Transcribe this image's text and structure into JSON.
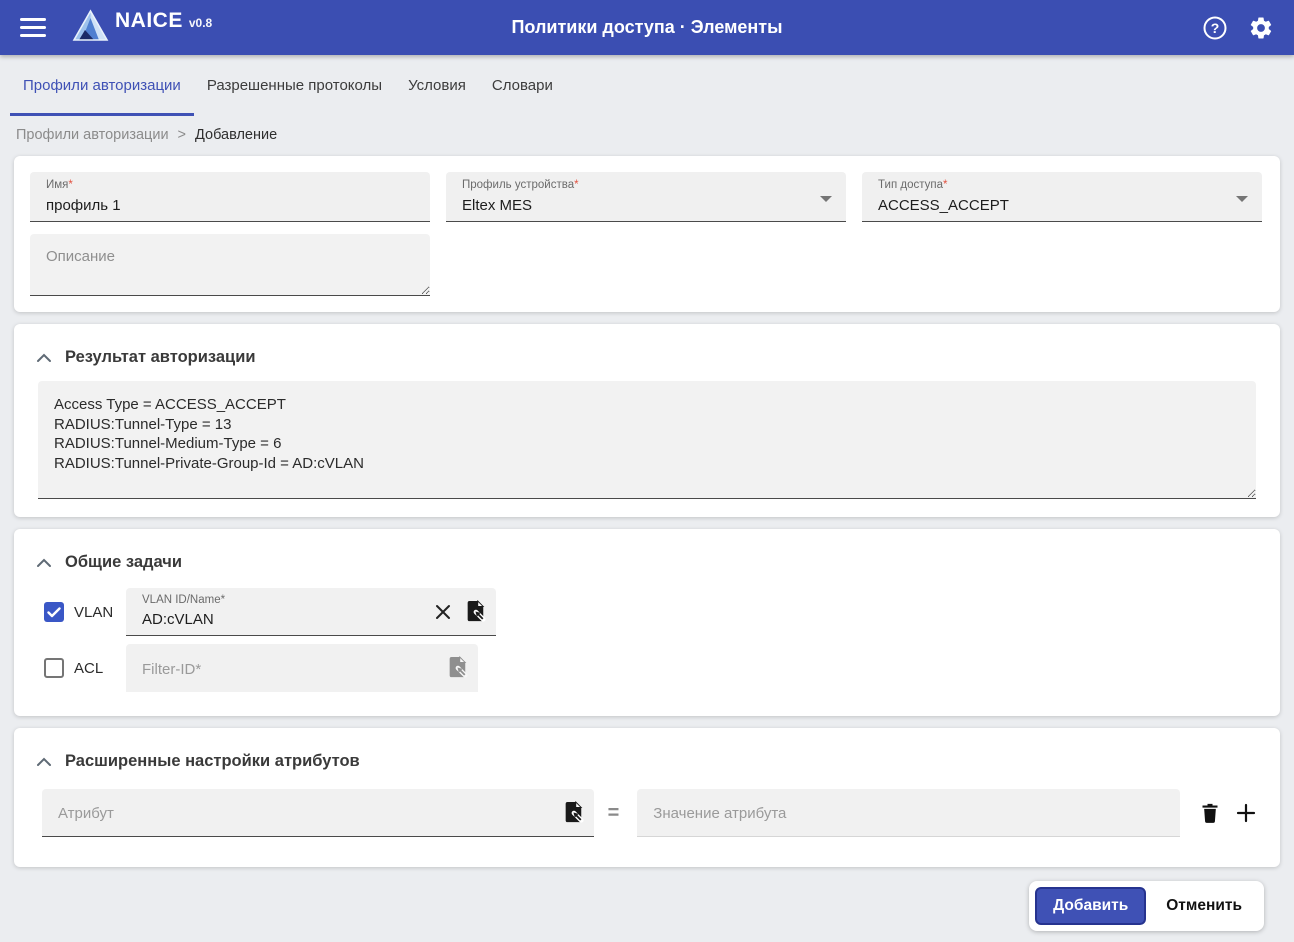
{
  "colors": {
    "header_bg": "#3b4eb2",
    "accent": "#3f51b5",
    "checkbox_blue": "#3a57c6",
    "required_red": "#e25241",
    "page_bg": "#ebedf0"
  },
  "ui": {
    "required_marker": "*"
  },
  "icons": {
    "help_glyph": "?"
  },
  "header": {
    "app_name": "NAICE",
    "version": "v0.8",
    "title": "Политики доступа · Элементы"
  },
  "tabs": [
    {
      "label": "Профили авторизации",
      "active": true
    },
    {
      "label": "Разрешенные протоколы",
      "active": false
    },
    {
      "label": "Условия",
      "active": false
    },
    {
      "label": "Словари",
      "active": false
    }
  ],
  "breadcrumb": {
    "parent": "Профили авторизации",
    "separator": ">",
    "current": "Добавление"
  },
  "form": {
    "name": {
      "label": "Имя",
      "value": "профиль 1"
    },
    "device_profile": {
      "label": "Профиль устройства",
      "value": "Eltex MES"
    },
    "access_type": {
      "label": "Тип доступа",
      "value": "ACCESS_ACCEPT"
    },
    "description": {
      "placeholder": "Описание"
    }
  },
  "auth_result": {
    "title": "Результат авторизации",
    "content": "Access Type = ACCESS_ACCEPT\nRADIUS:Tunnel-Type = 13\nRADIUS:Tunnel-Medium-Type = 6\nRADIUS:Tunnel-Private-Group-Id = AD:cVLAN"
  },
  "common_tasks": {
    "title": "Общие задачи",
    "vlan": {
      "checkbox_label": "VLAN",
      "checked": true,
      "field_label": "VLAN ID/Name",
      "value": "AD:cVLAN"
    },
    "acl": {
      "checkbox_label": "ACL",
      "checked": false,
      "placeholder": "Filter-ID*"
    }
  },
  "advanced": {
    "title": "Расширенные настройки атрибутов",
    "attribute_placeholder": "Атрибут",
    "equals": "=",
    "value_placeholder": "Значение атрибута"
  },
  "footer": {
    "submit_label": "Добавить",
    "cancel_label": "Отменить"
  }
}
